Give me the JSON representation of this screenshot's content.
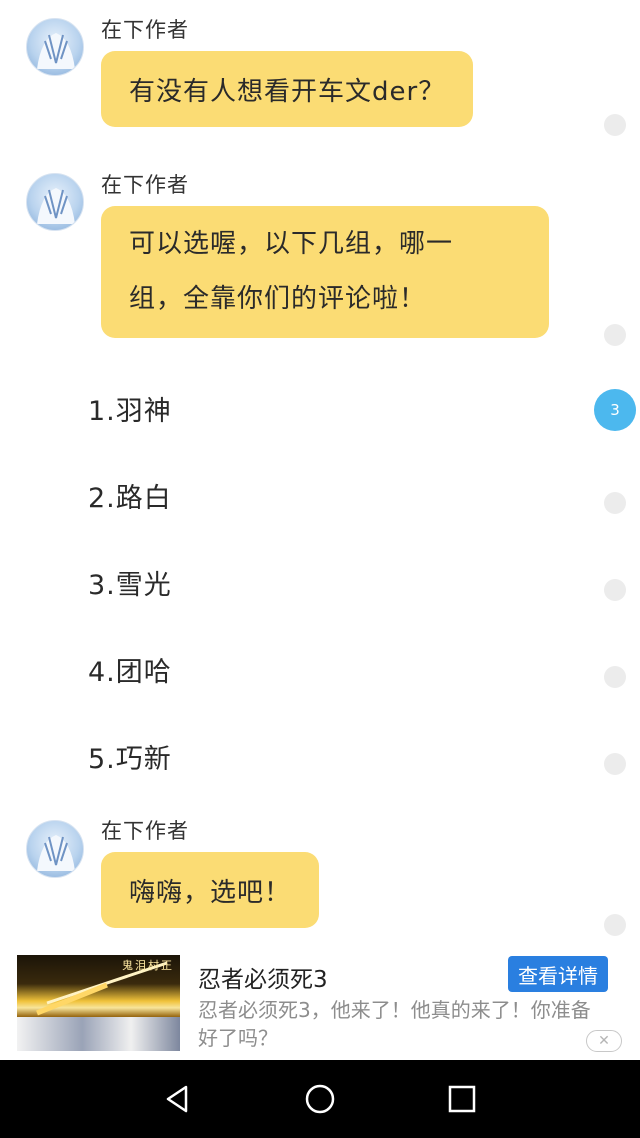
{
  "messages": [
    {
      "sender": "在下作者",
      "text": "有没有人想看开车文der？"
    },
    {
      "sender": "在下作者",
      "lines": [
        "可以选喔，以下几组，哪一",
        "组，全靠你们的评论啦！"
      ]
    },
    {
      "sender": "在下作者",
      "text": "嗨嗨，选吧！"
    }
  ],
  "options": [
    "1.羽神",
    "2.路白",
    "3.雪光",
    "4.团哈",
    "5.巧新"
  ],
  "comment_badge": "3",
  "ad": {
    "thumb_text": "鬼泪村正",
    "title": "忍者必须死3",
    "button": "查看详情",
    "description": "忍者必须死3，他来了！他真的来了！你准备好了吗？",
    "close": "✕"
  },
  "colors": {
    "bubble": "#fbdc74",
    "badge": "#4cb8ee",
    "ad_button": "#2a7fe0"
  },
  "icons": [
    "back-icon",
    "home-icon",
    "recent-apps-icon",
    "close-icon"
  ]
}
